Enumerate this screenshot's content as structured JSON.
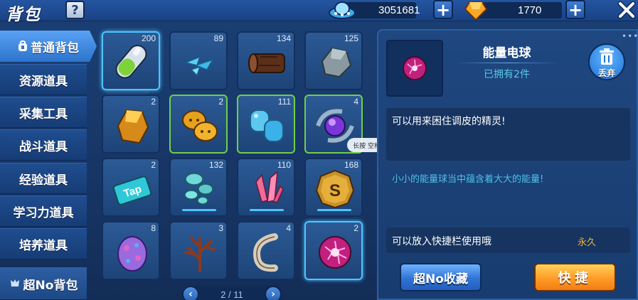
{
  "header": {
    "title": "背包",
    "help_label": "?",
    "resources": [
      {
        "icon": "ufo-coin-icon",
        "value": "3051681"
      },
      {
        "icon": "orange-gem-icon",
        "value": "1770"
      }
    ],
    "plus_label": "+",
    "close_icon": "close-icon"
  },
  "tabs": [
    {
      "label": "普通背包",
      "active": true
    },
    {
      "label": "资源道具"
    },
    {
      "label": "采集工具"
    },
    {
      "label": "战斗道具"
    },
    {
      "label": "经验道具"
    },
    {
      "label": "学习力道具"
    },
    {
      "label": "培养道具"
    },
    {
      "label": "超No背包"
    }
  ],
  "grid": {
    "items": [
      {
        "icon": "capsule-icon",
        "count": "200"
      },
      {
        "icon": "blue-crystal-shards-icon",
        "count": "89"
      },
      {
        "icon": "wood-log-icon",
        "count": "134"
      },
      {
        "icon": "stone-ore-icon",
        "count": "125"
      },
      {
        "icon": "gold-ore-icon",
        "count": "2"
      },
      {
        "icon": "golden-buns-icon",
        "count": "2"
      },
      {
        "icon": "blue-jelly-icon",
        "count": "111"
      },
      {
        "icon": "purple-energy-orb-icon",
        "count": "4"
      },
      {
        "icon": "tap-ticket-icon",
        "count": "2"
      },
      {
        "icon": "cyan-pebbles-icon",
        "count": "132"
      },
      {
        "icon": "pink-crystal-icon",
        "count": "110"
      },
      {
        "icon": "s-coin-icon",
        "count": "168"
      },
      {
        "icon": "spotted-egg-icon",
        "count": "8"
      },
      {
        "icon": "coral-branch-icon",
        "count": "3"
      },
      {
        "icon": "claw-fossil-icon",
        "count": "4"
      },
      {
        "icon": "energy-ball-icon",
        "count": "2"
      }
    ],
    "tooltip": "长按 空格 连击"
  },
  "pager": {
    "page": "2 / 11",
    "prev": "‹",
    "next": "›"
  },
  "detail": {
    "name": "能量电球",
    "owned": "已拥有2件",
    "discard_label": "丢弃",
    "description": "可以用来困住调皮的精灵!",
    "flavor": "小小的能量球当中蕴含着大大的能量!",
    "usage": "可以放入快捷栏使用哦",
    "duration": "永久",
    "favorite_label": "超No收藏",
    "quick_label": "快捷"
  },
  "colors": {
    "accent_blue": "#4fc4ff",
    "green_border": "#6fcf4a",
    "gold": "#f2b13a",
    "cyan_text": "#4fc0e6"
  }
}
